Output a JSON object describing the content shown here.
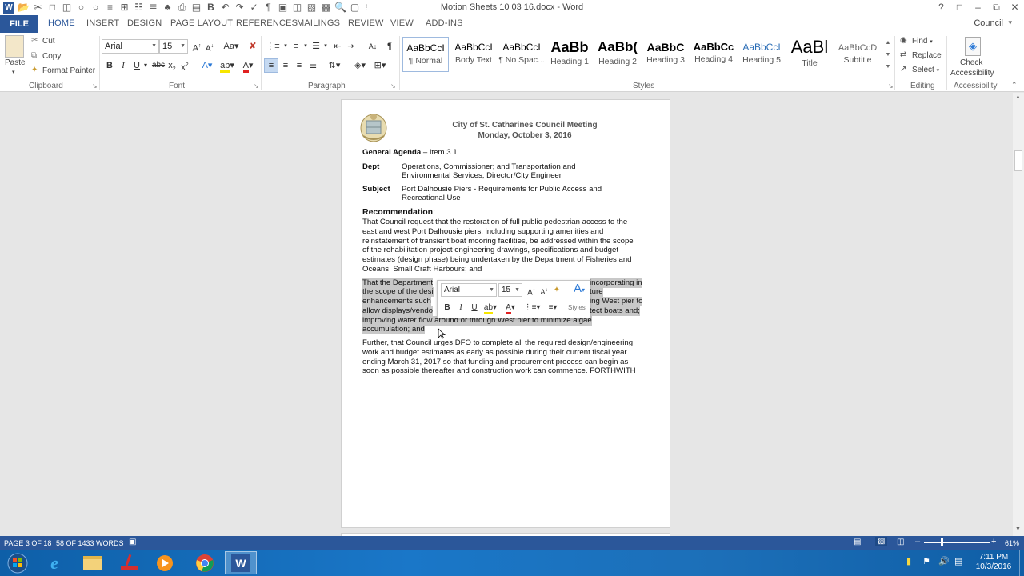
{
  "window": {
    "title": "Motion Sheets 10 03 16.docx - Word",
    "help": "?",
    "user": "Council"
  },
  "tabs": [
    "FILE",
    "HOME",
    "INSERT",
    "DESIGN",
    "PAGE LAYOUT",
    "REFERENCES",
    "MAILINGS",
    "REVIEW",
    "VIEW",
    "ADD-INS"
  ],
  "active_tab": "HOME",
  "clipboard": {
    "group_label": "Clipboard",
    "paste": "Paste",
    "cut": "Cut",
    "copy": "Copy",
    "format_painter": "Format Painter"
  },
  "font": {
    "group_label": "Font",
    "font_name": "Arial",
    "font_size": "15"
  },
  "paragraph": {
    "group_label": "Paragraph"
  },
  "styles": {
    "group_label": "Styles",
    "items": [
      {
        "sample": "AaBbCcI",
        "name": "¶ Normal"
      },
      {
        "sample": "AaBbCcI",
        "name": "Body Text"
      },
      {
        "sample": "AaBbCcI",
        "name": "¶ No Spac..."
      },
      {
        "sample": "AaBb",
        "name": "Heading 1"
      },
      {
        "sample": "AaBb(",
        "name": "Heading 2"
      },
      {
        "sample": "AaBbC",
        "name": "Heading 3"
      },
      {
        "sample": "AaBbCc",
        "name": "Heading 4"
      },
      {
        "sample": "AaBbCcI",
        "name": "Heading 5"
      },
      {
        "sample": "AaBl",
        "name": "Title"
      },
      {
        "sample": "AaBbCcD",
        "name": "Subtitle"
      }
    ]
  },
  "editing": {
    "group_label": "Editing",
    "find": "Find",
    "replace": "Replace",
    "select": "Select"
  },
  "accessibility": {
    "group_label": "Accessibility",
    "check_line1": "Check",
    "check_line2": "Accessibility"
  },
  "document": {
    "header_line1": "City of St. Catharines Council Meeting",
    "header_line2": "Monday, October 3, 2016",
    "agenda_label": "General Agenda",
    "agenda_item": " – Item 3.1",
    "dept_label": "Dept",
    "dept_line1": "Operations, Commissioner; and Transportation and",
    "dept_line2": "Environmental Services, Director/City Engineer",
    "subject_label": "Subject",
    "subject_line1": "Port Dalhousie Piers - Requirements for Public Access and",
    "subject_line2": "Recreational Use",
    "recommendation_label": "Recommendation",
    "para1": [
      "That Council request that the restoration of full public pedestrian access to the",
      "east and west Port Dalhousie piers, including supporting amenities and",
      "reinstatement of transient boat mooring facilities, be addressed within the scope",
      "of the rehabilitation project engineering drawings, specifications and budget",
      "estimates (design phase) being undertaken by the Department of Fisheries and",
      "Oceans, Small Craft Harbours; and"
    ],
    "para2": [
      {
        "left": "That the Department",
        "right": "incorporating in"
      },
      {
        "left": "the scope of the desi",
        "right": "ture"
      },
      {
        "left": "enhancements such",
        "right": "ing West pier to"
      },
      {
        "left": "allow displays/vendo",
        "right": "tect boats and;"
      },
      {
        "left": "improving water flow around or through West pier to minimize algae",
        "right": ""
      },
      {
        "left": "accumulation; and",
        "right": ""
      }
    ],
    "para3": [
      "Further, that Council urges DFO to complete all the required design/engineering",
      "work and budget estimates as early as possible during their current fiscal year",
      "ending March 31, 2017 so that funding and procurement process can begin as",
      "soon as possible thereafter and construction work can commence. FORTHWITH"
    ]
  },
  "mini_toolbar": {
    "font_name": "Arial",
    "font_size": "15",
    "styles_label": "Styles"
  },
  "status": {
    "page": "PAGE 3 OF 18",
    "words": "58 OF 1433 WORDS",
    "zoom": "61%"
  },
  "taskbar": {
    "time": "7:11 PM",
    "date": "10/3/2016"
  },
  "colors": {
    "accent": "#2b579a",
    "selection": "#c8c8c8"
  }
}
